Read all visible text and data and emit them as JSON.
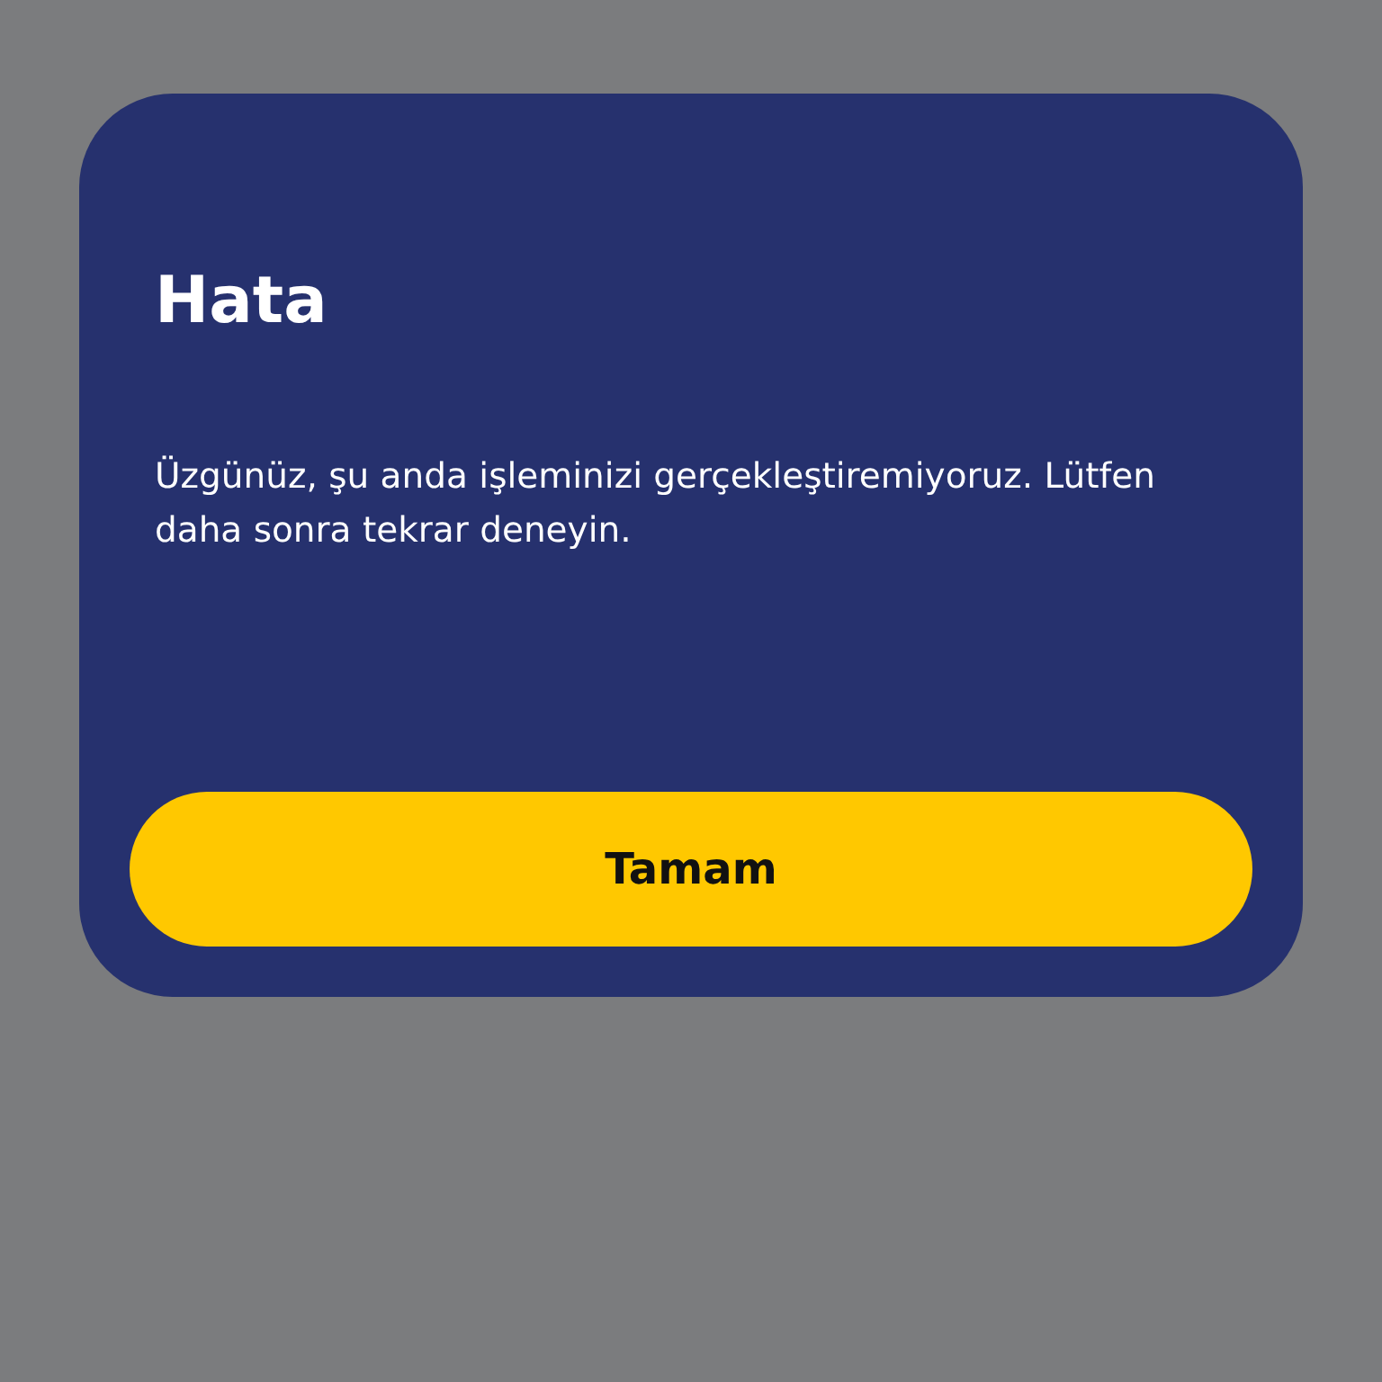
{
  "dialog": {
    "title": "Hata",
    "message": "Üzgünüz, şu anda işleminizi gerçekleştiremiyoruz. Lütfen daha sonra tekrar deneyin.",
    "buttons": [
      "Tamam"
    ]
  }
}
